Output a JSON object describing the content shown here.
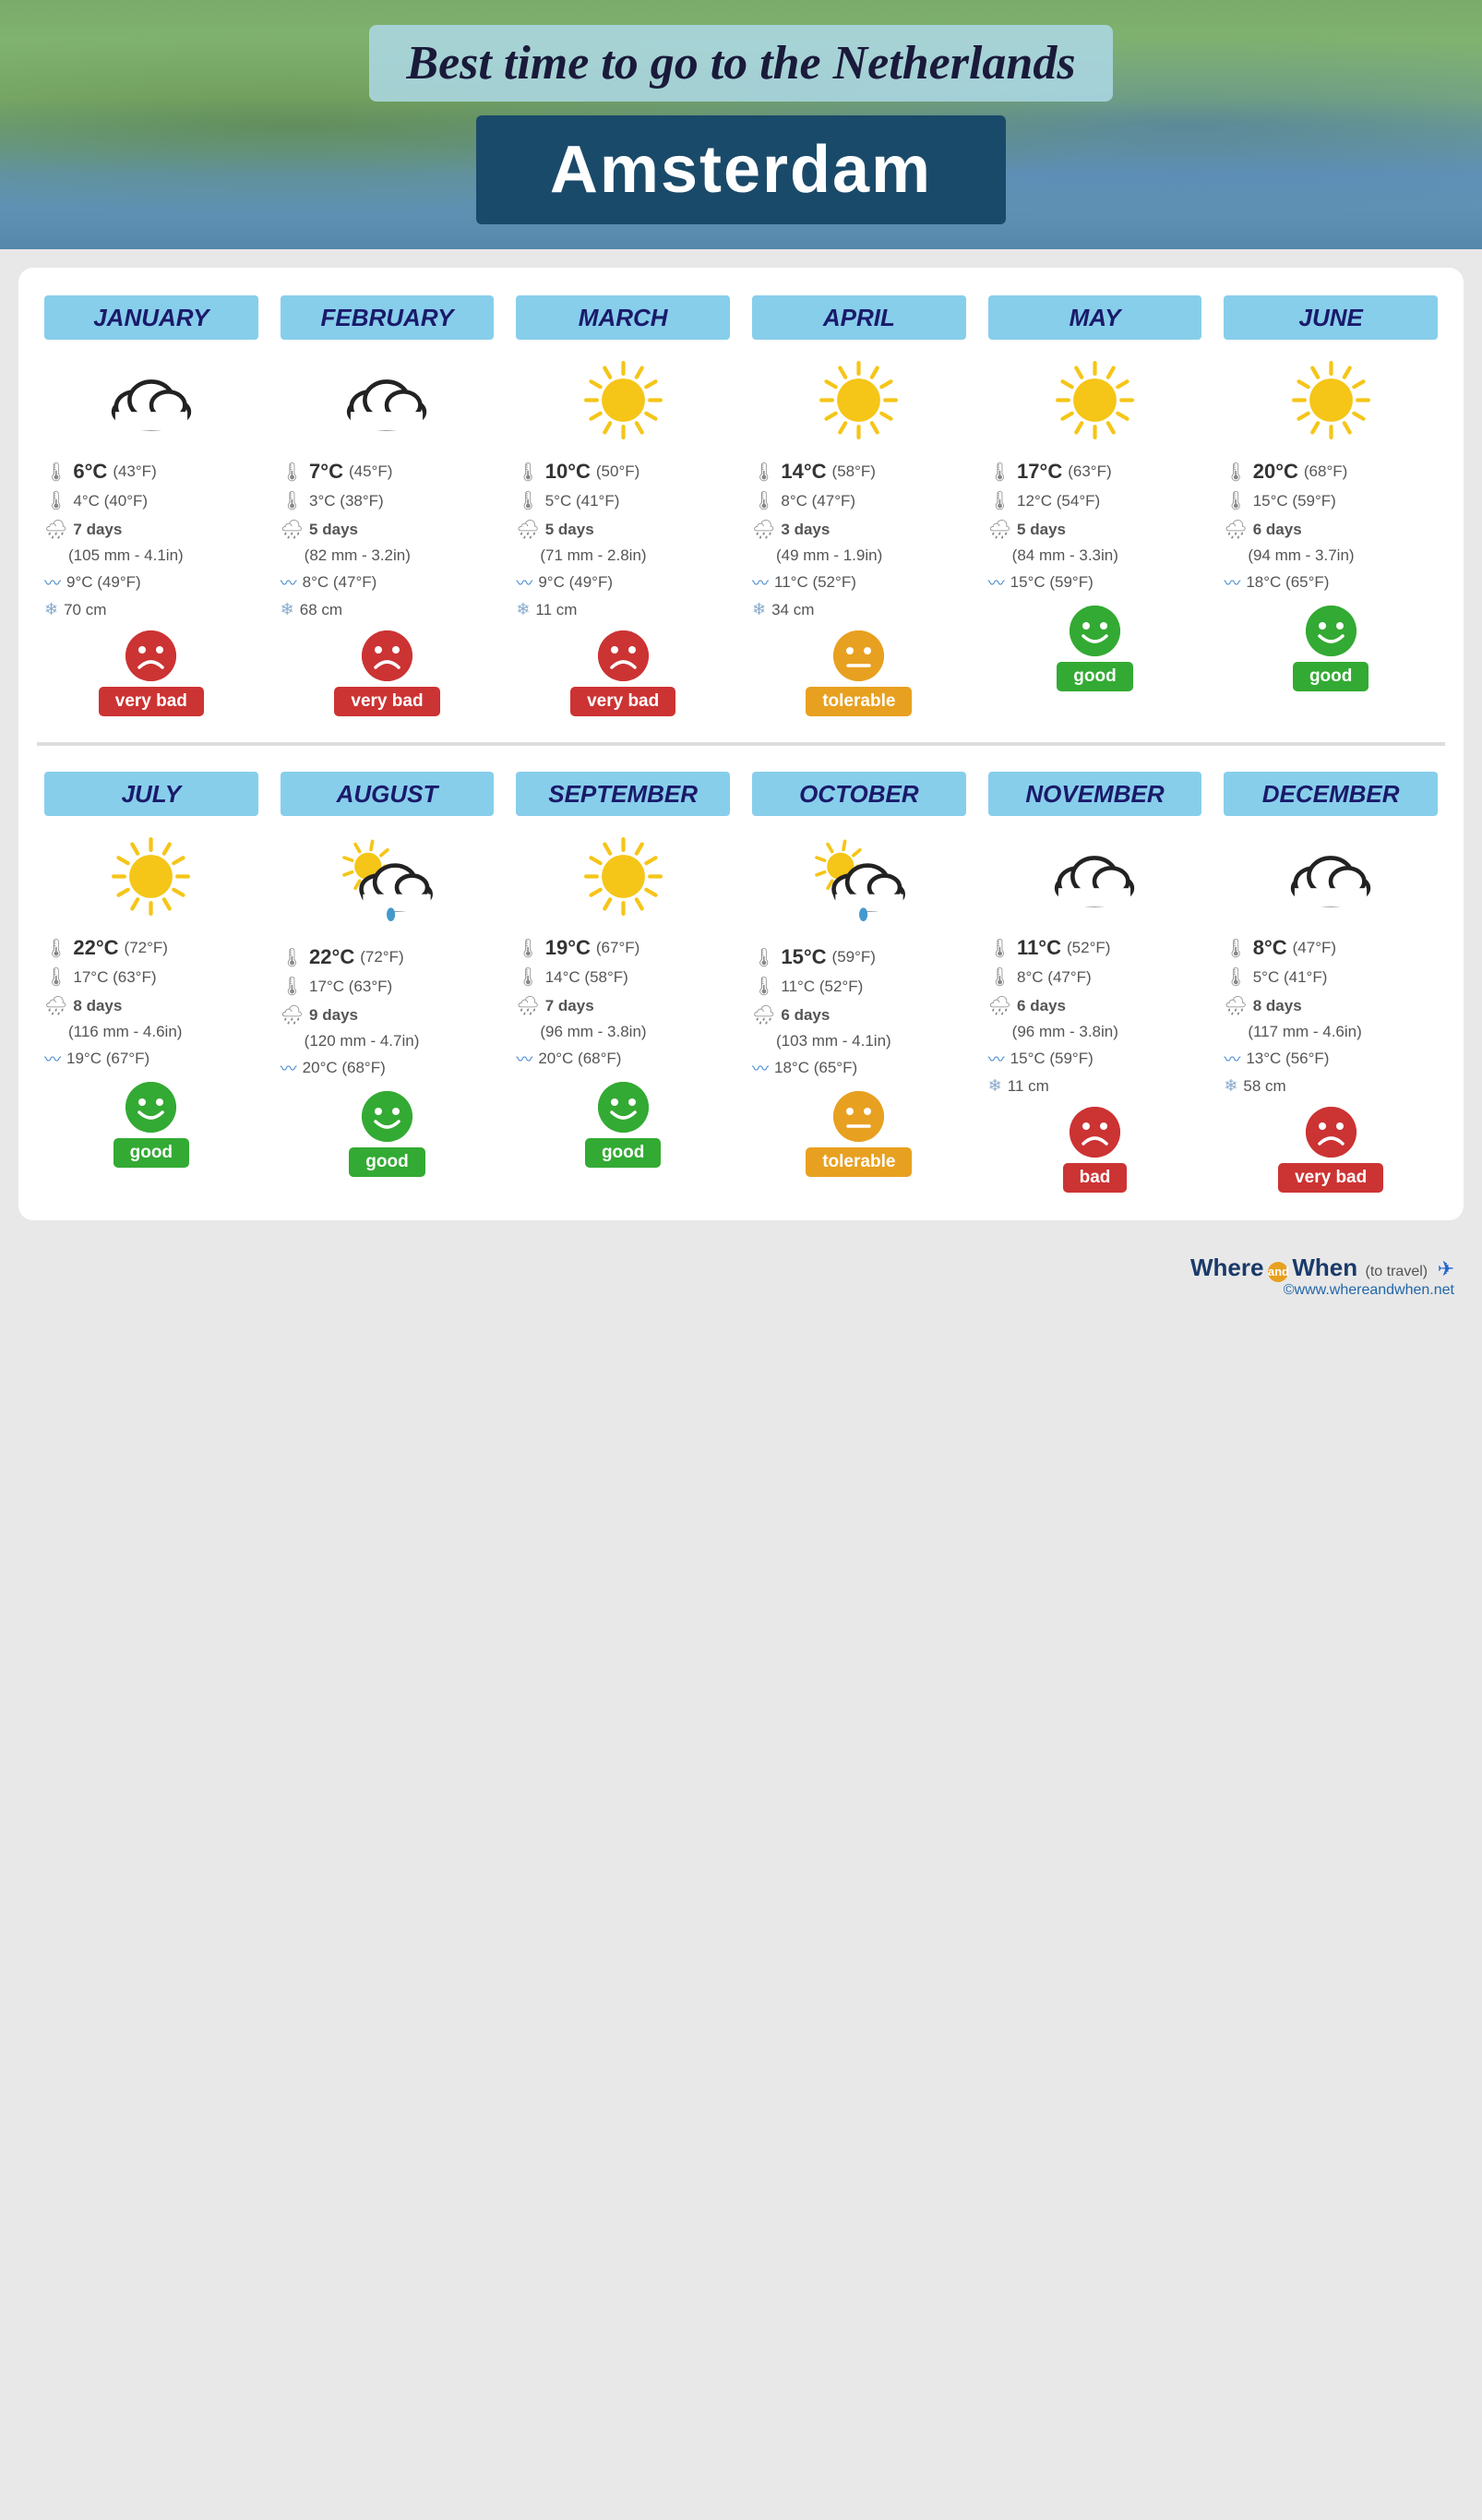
{
  "header": {
    "title": "Best time to go to the Netherlands",
    "city": "Amsterdam"
  },
  "months": [
    {
      "name": "JANUARY",
      "weather_type": "cloud",
      "high_temp": "6°C",
      "high_temp_f": "(43°F)",
      "low_temp": "4°C (40°F)",
      "rain_days": "7 days",
      "rain_mm": "(105 mm - 4.1in)",
      "sea_temp": "9°C (49°F)",
      "snow": "70 cm",
      "has_snow": true,
      "rating": "very bad",
      "rating_class": "very-bad"
    },
    {
      "name": "FEBRUARY",
      "weather_type": "cloud",
      "high_temp": "7°C",
      "high_temp_f": "(45°F)",
      "low_temp": "3°C (38°F)",
      "rain_days": "5 days",
      "rain_mm": "(82 mm - 3.2in)",
      "sea_temp": "8°C (47°F)",
      "snow": "68 cm",
      "has_snow": true,
      "rating": "very bad",
      "rating_class": "very-bad"
    },
    {
      "name": "MARCH",
      "weather_type": "sun",
      "high_temp": "10°C",
      "high_temp_f": "(50°F)",
      "low_temp": "5°C (41°F)",
      "rain_days": "5 days",
      "rain_mm": "(71 mm - 2.8in)",
      "sea_temp": "9°C (49°F)",
      "snow": "11 cm",
      "has_snow": true,
      "rating": "very bad",
      "rating_class": "very-bad"
    },
    {
      "name": "APRIL",
      "weather_type": "sun",
      "high_temp": "14°C",
      "high_temp_f": "(58°F)",
      "low_temp": "8°C (47°F)",
      "rain_days": "3 days",
      "rain_mm": "(49 mm - 1.9in)",
      "sea_temp": "11°C (52°F)",
      "snow": "34 cm",
      "has_snow": true,
      "rating": "tolerable",
      "rating_class": "tolerable"
    },
    {
      "name": "MAY",
      "weather_type": "sun",
      "high_temp": "17°C",
      "high_temp_f": "(63°F)",
      "low_temp": "12°C (54°F)",
      "rain_days": "5 days",
      "rain_mm": "(84 mm - 3.3in)",
      "sea_temp": "15°C (59°F)",
      "snow": null,
      "has_snow": false,
      "rating": "good",
      "rating_class": "good"
    },
    {
      "name": "JUNE",
      "weather_type": "sun",
      "high_temp": "20°C",
      "high_temp_f": "(68°F)",
      "low_temp": "15°C (59°F)",
      "rain_days": "6 days",
      "rain_mm": "(94 mm - 3.7in)",
      "sea_temp": "18°C (65°F)",
      "snow": null,
      "has_snow": false,
      "rating": "good",
      "rating_class": "good"
    },
    {
      "name": "JULY",
      "weather_type": "sun",
      "high_temp": "22°C",
      "high_temp_f": "(72°F)",
      "low_temp": "17°C (63°F)",
      "rain_days": "8 days",
      "rain_mm": "(116 mm - 4.6in)",
      "sea_temp": "19°C (67°F)",
      "snow": null,
      "has_snow": false,
      "rating": "good",
      "rating_class": "good"
    },
    {
      "name": "AUGUST",
      "weather_type": "sun-cloud-rain",
      "high_temp": "22°C",
      "high_temp_f": "(72°F)",
      "low_temp": "17°C (63°F)",
      "rain_days": "9 days",
      "rain_mm": "(120 mm - 4.7in)",
      "sea_temp": "20°C (68°F)",
      "snow": null,
      "has_snow": false,
      "rating": "good",
      "rating_class": "good"
    },
    {
      "name": "SEPTEMBER",
      "weather_type": "sun",
      "high_temp": "19°C",
      "high_temp_f": "(67°F)",
      "low_temp": "14°C (58°F)",
      "rain_days": "7 days",
      "rain_mm": "(96 mm - 3.8in)",
      "sea_temp": "20°C (68°F)",
      "snow": null,
      "has_snow": false,
      "rating": "good",
      "rating_class": "good"
    },
    {
      "name": "OCTOBER",
      "weather_type": "sun-cloud-rain",
      "high_temp": "15°C",
      "high_temp_f": "(59°F)",
      "low_temp": "11°C (52°F)",
      "rain_days": "6 days",
      "rain_mm": "(103 mm - 4.1in)",
      "sea_temp": "18°C (65°F)",
      "snow": null,
      "has_snow": false,
      "rating": "tolerable",
      "rating_class": "tolerable"
    },
    {
      "name": "NOVEMBER",
      "weather_type": "cloud",
      "high_temp": "11°C",
      "high_temp_f": "(52°F)",
      "low_temp": "8°C (47°F)",
      "rain_days": "6 days",
      "rain_mm": "(96 mm - 3.8in)",
      "sea_temp": "15°C (59°F)",
      "snow": "11 cm",
      "has_snow": true,
      "rating": "bad",
      "rating_class": "bad"
    },
    {
      "name": "DECEMBER",
      "weather_type": "cloud",
      "high_temp": "8°C",
      "high_temp_f": "(47°F)",
      "low_temp": "5°C (41°F)",
      "rain_days": "8 days",
      "rain_mm": "(117 mm - 4.6in)",
      "sea_temp": "13°C (56°F)",
      "snow": "58 cm",
      "has_snow": true,
      "rating": "very bad",
      "rating_class": "very-bad"
    }
  ],
  "footer": {
    "brand": "Where",
    "and": "and",
    "when": "When",
    "tagline": "(to travel)",
    "url": "©www.whereandwhen.net"
  }
}
